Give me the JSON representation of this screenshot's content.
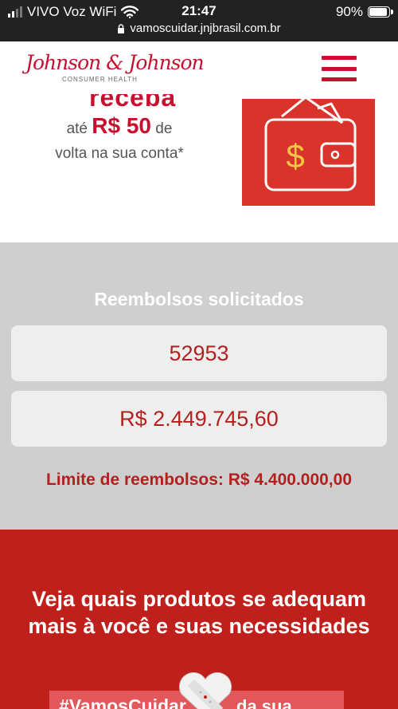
{
  "status_bar": {
    "carrier": "VIVO Voz WiFi",
    "time": "21:47",
    "battery": "90%",
    "battery_level": 0.9,
    "url": "vamoscuidar.jnjbrasil.com.br"
  },
  "header": {
    "logo_text": "Johnson & Johnson",
    "logo_subtitle": "CONSUMER HEALTH",
    "menu_icon": "hamburger-icon"
  },
  "hero": {
    "cut_title": "receba",
    "prefix": "até",
    "amount": "R$ 50",
    "suffix": "de",
    "line2": "volta na sua conta*",
    "wallet_icon": "wallet-dollar-icon",
    "accent_color": "#d9342b"
  },
  "stats": {
    "title": "Reembolsos solicitados",
    "count": "52953",
    "amount": "R$ 2.449.745,60",
    "limit": "Limite de reembolsos: R$ 4.400.000,00"
  },
  "cta": {
    "text": "Veja quais produtos se adequam mais à você e suas necessidades",
    "banner_left": "#VamosCuidar",
    "banner_right": "da sua beleza",
    "bandage_icon": "bandage-heart-icon",
    "bg_color": "#c0201c"
  }
}
